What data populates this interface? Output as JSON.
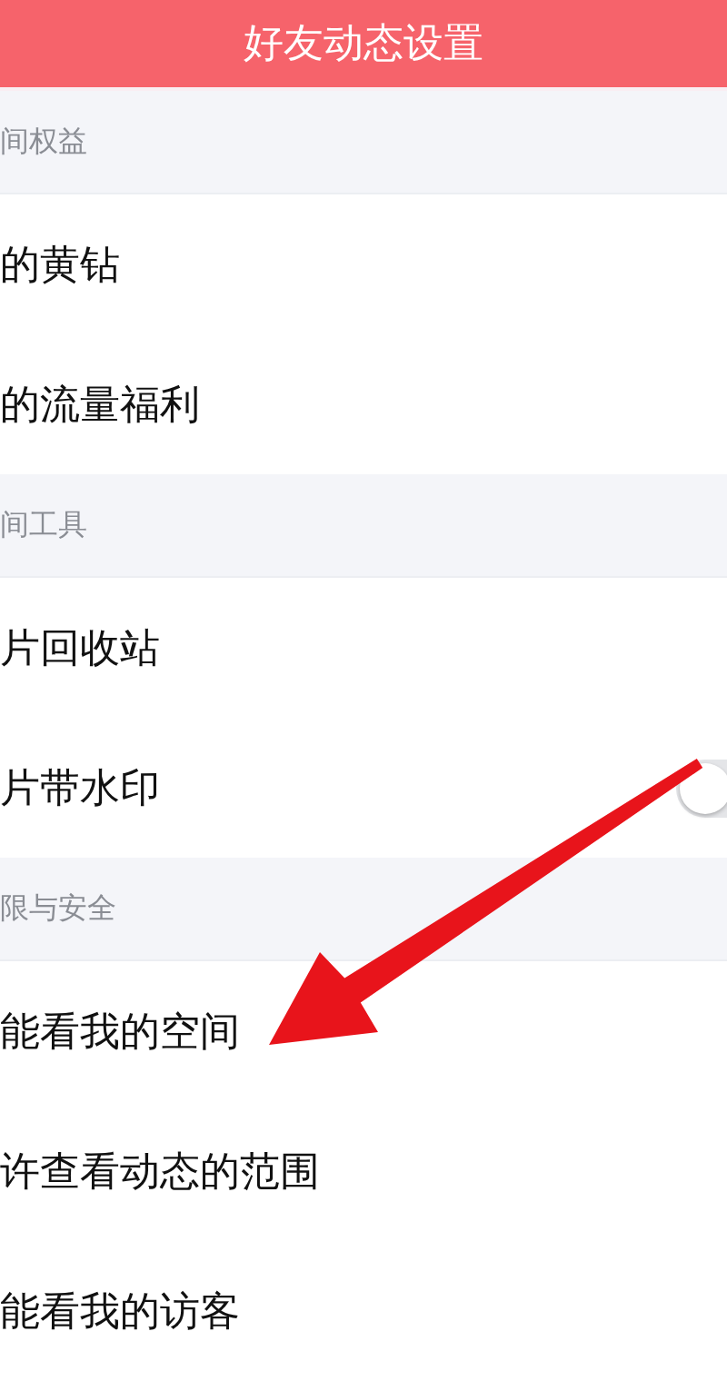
{
  "window": {
    "title": "好友动态设置"
  },
  "sections": [
    {
      "title": "间权益",
      "items": [
        {
          "label": "的黄钻",
          "kind": "link"
        },
        {
          "label": "的流量福利",
          "kind": "link"
        }
      ]
    },
    {
      "title": "间工具",
      "items": [
        {
          "label": "片回收站",
          "kind": "link"
        },
        {
          "label": "片带水印",
          "kind": "toggle",
          "on": false
        }
      ]
    },
    {
      "title": "限与安全",
      "items": [
        {
          "label": "能看我的空间",
          "kind": "link"
        },
        {
          "label": "许查看动态的范围",
          "kind": "link"
        },
        {
          "label": "能看我的访客",
          "kind": "link"
        }
      ]
    }
  ],
  "annotation": {
    "kind": "arrow"
  }
}
